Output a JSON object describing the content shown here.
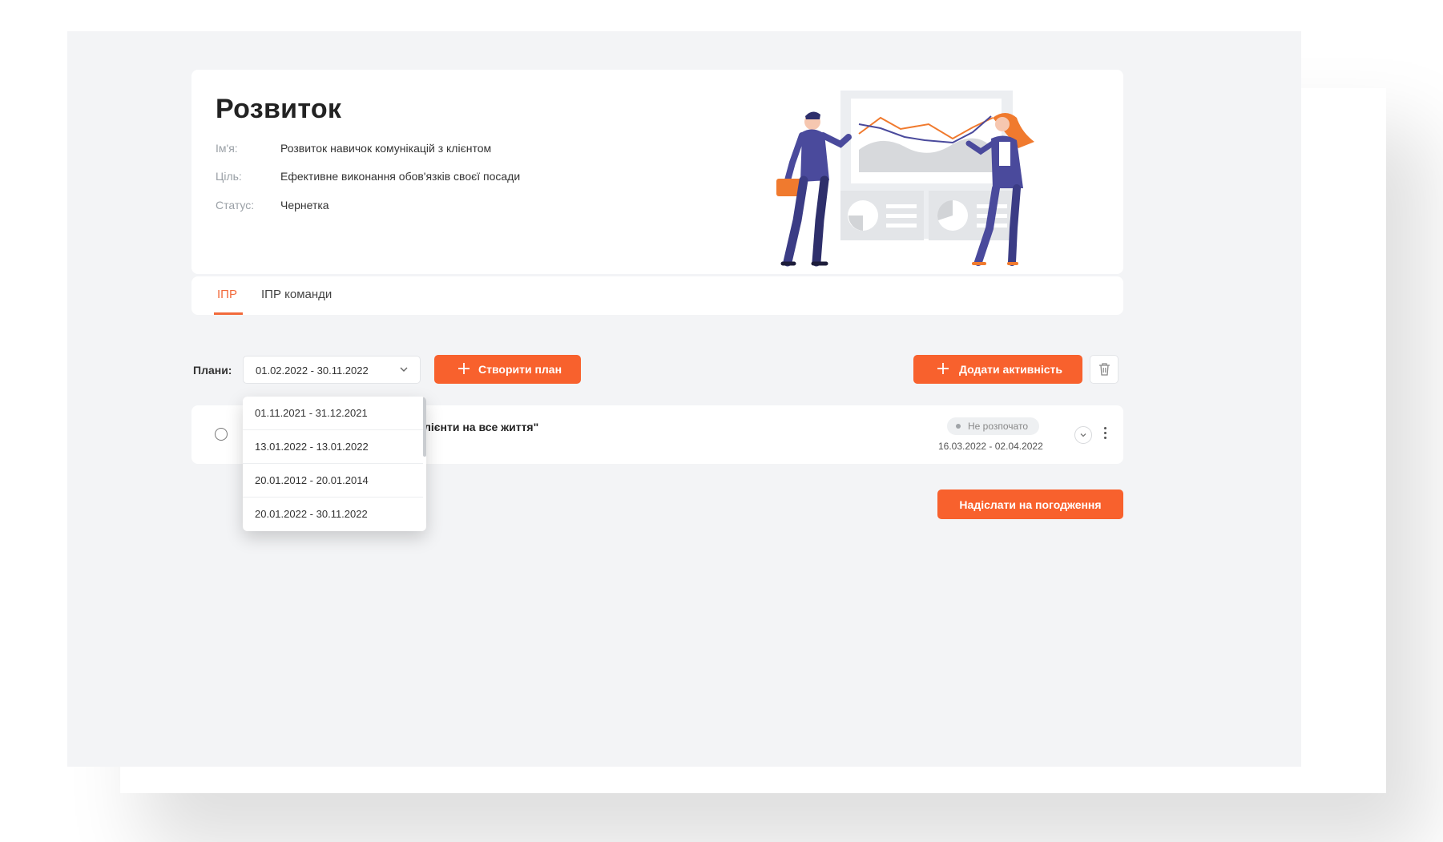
{
  "header": {
    "title": "Розвиток",
    "fields": [
      {
        "label": "Ім'я:",
        "value": "Розвиток навичок комунікацій з клієнтом"
      },
      {
        "label": "Ціль:",
        "value": "Ефективне виконання обов'язків своєї посади"
      },
      {
        "label": "Статус:",
        "value": "Чернетка"
      }
    ]
  },
  "tabs": [
    {
      "label": "ІПР",
      "active": true
    },
    {
      "label": "ІПР команди",
      "active": false
    }
  ],
  "plans": {
    "label": "Плани:",
    "selected": "01.02.2022 - 30.11.2022",
    "options": [
      "01.11.2021 - 31.12.2021",
      "13.01.2022 - 13.01.2022",
      "20.01.2012 - 20.01.2014",
      "20.01.2022 - 30.11.2022"
    ],
    "dropdown_open": true
  },
  "toolbar": {
    "create_plan": "Створити план",
    "add_activity": "Додати активність",
    "delete_icon": "trash-icon"
  },
  "activity": {
    "title": "лієнти на все життя\"",
    "status": "Не розпочато",
    "date_range": "16.03.2022 - 02.04.2022"
  },
  "footer": {
    "send_for_approval": "Надіслати на погодження"
  },
  "colors": {
    "accent": "#f8612d",
    "tab_active": "#f26a3b",
    "frame_bg": "#f3f4f6",
    "illustration_primary": "#4a4a9c",
    "illustration_orange": "#f07a2e"
  }
}
